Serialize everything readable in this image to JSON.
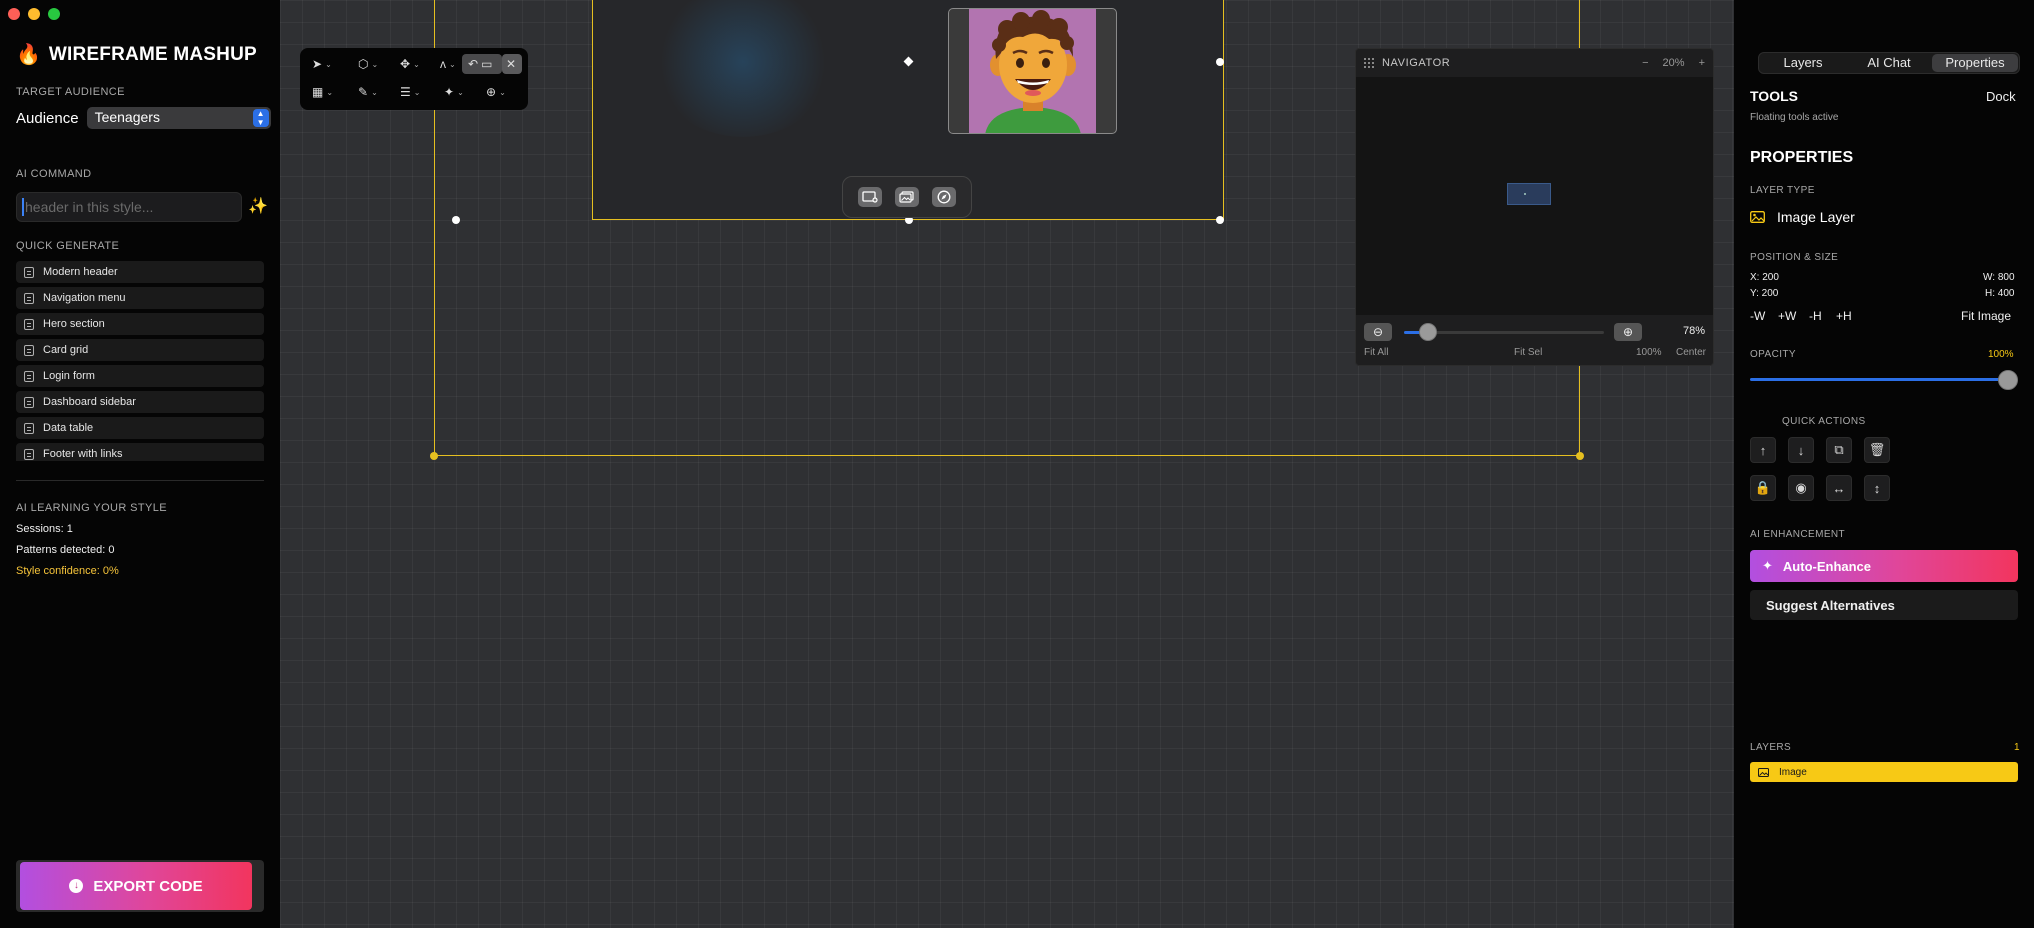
{
  "window": {
    "controls": [
      "close",
      "minimize",
      "maximize"
    ]
  },
  "brand": {
    "icon": "flame-icon",
    "name": "WIREFRAME MASHUP"
  },
  "audience": {
    "section_label": "TARGET AUDIENCE",
    "label": "Audience",
    "value": "Teenagers"
  },
  "ai_command": {
    "section_label": "AI COMMAND",
    "placeholder": "header in this style...",
    "value": ""
  },
  "quick_generate": {
    "section_label": "QUICK GENERATE",
    "items": [
      "Modern header",
      "Navigation menu",
      "Hero section",
      "Card grid",
      "Login form",
      "Dashboard sidebar",
      "Data table",
      "Footer with links"
    ]
  },
  "learning": {
    "section_label": "AI LEARNING YOUR STYLE",
    "sessions": "Sessions: 1",
    "patterns": "Patterns detected: 0",
    "confidence": "Style confidence: 0%"
  },
  "export": {
    "label": "EXPORT CODE"
  },
  "navigator": {
    "title": "NAVIGATOR",
    "zoom_minus": "−",
    "zoom_value": "20%",
    "zoom_plus": "+",
    "zoom_percent": "78%",
    "slider_fraction": 0.12,
    "footer": {
      "fit_all": "Fit All",
      "fit_sel": "Fit Sel",
      "hundred": "100%",
      "center": "Center"
    }
  },
  "right_panel": {
    "tabs": [
      "Layers",
      "AI Chat",
      "Properties"
    ],
    "active_tab": 2,
    "tools": {
      "title": "TOOLS",
      "dock": "Dock",
      "status": "Floating tools active"
    },
    "properties": {
      "title": "PROPERTIES",
      "layer_type_label": "LAYER TYPE",
      "layer_type": "Image Layer",
      "pos_size_label": "POSITION & SIZE",
      "x": "X: 200",
      "y": "Y: 200",
      "w": "W: 800",
      "h": "H: 400",
      "size_buttons": [
        "-W",
        "+W",
        "-H",
        "+H"
      ],
      "fit_image": "Fit Image",
      "opacity_label": "OPACITY",
      "opacity_value": "100%",
      "opacity_fraction": 1.0
    },
    "quick_actions": {
      "label": "QUICK ACTIONS",
      "icons": [
        "arrow-up-icon",
        "arrow-down-icon",
        "duplicate-icon",
        "trash-icon",
        "lock-icon",
        "hide-icon",
        "flip-horizontal-icon",
        "flip-vertical-icon"
      ]
    },
    "ai_enhancement": {
      "label": "AI ENHANCEMENT",
      "auto_enhance": "Auto-Enhance",
      "suggest": "Suggest Alternatives"
    },
    "layers": {
      "label": "LAYERS",
      "count": "1",
      "items": [
        "Image"
      ]
    }
  },
  "colors": {
    "accent_yellow": "#f7c915",
    "accent_blue": "#2b6fe6",
    "gradient_start": "#b24fe0",
    "gradient_end": "#f2355e"
  }
}
